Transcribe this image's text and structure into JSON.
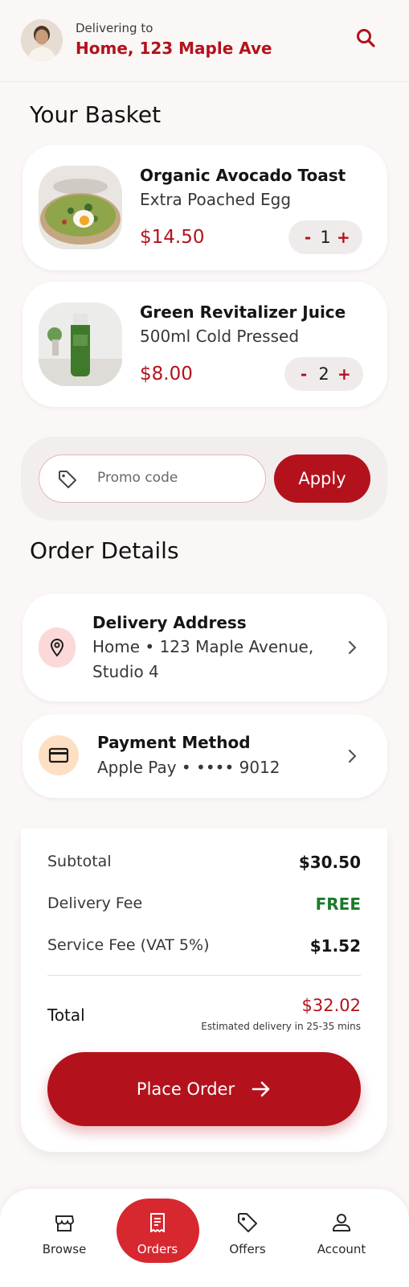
{
  "header": {
    "deliver_label": "Delivering to",
    "deliver_address": "Home, 123 Maple Ave"
  },
  "basket": {
    "title": "Your Basket",
    "items": [
      {
        "name": "Organic Avocado Toast",
        "option": "Extra Poached Egg",
        "price": "$14.50",
        "quantity": "1"
      },
      {
        "name": "Green Revitalizer Juice",
        "option": "500ml Cold Pressed",
        "price": "$8.00",
        "quantity": "2"
      }
    ],
    "decrement": "-",
    "increment": "+"
  },
  "promo": {
    "placeholder": "Promo code",
    "apply_label": "Apply"
  },
  "order_details": {
    "title": "Order Details",
    "delivery": {
      "title": "Delivery Address",
      "line1": "Home • 123 Maple Avenue,",
      "line2": "Studio 4"
    },
    "payment": {
      "title": "Payment Method",
      "value": "Apple Pay • •••• 9012"
    }
  },
  "summary": {
    "subtotal_label": "Subtotal",
    "subtotal_value": "$30.50",
    "delivery_label": "Delivery Fee",
    "delivery_value": "FREE",
    "service_label": "Service Fee (VAT 5%)",
    "service_value": "$1.52",
    "total_label": "Total",
    "total_value": "$32.02",
    "eta": "Estimated delivery in 25-35 mins",
    "place_order": "Place Order"
  },
  "nav": {
    "items": [
      {
        "label": "Browse",
        "icon": "storefront-icon"
      },
      {
        "label": "Orders",
        "icon": "receipt-icon",
        "active": true
      },
      {
        "label": "Offers",
        "icon": "tag-icon"
      },
      {
        "label": "Account",
        "icon": "person-icon"
      }
    ]
  },
  "colors": {
    "accent": "#b3121c",
    "active_nav": "#d8282f",
    "free": "#1b7a2a",
    "background": "#faf7f6"
  }
}
